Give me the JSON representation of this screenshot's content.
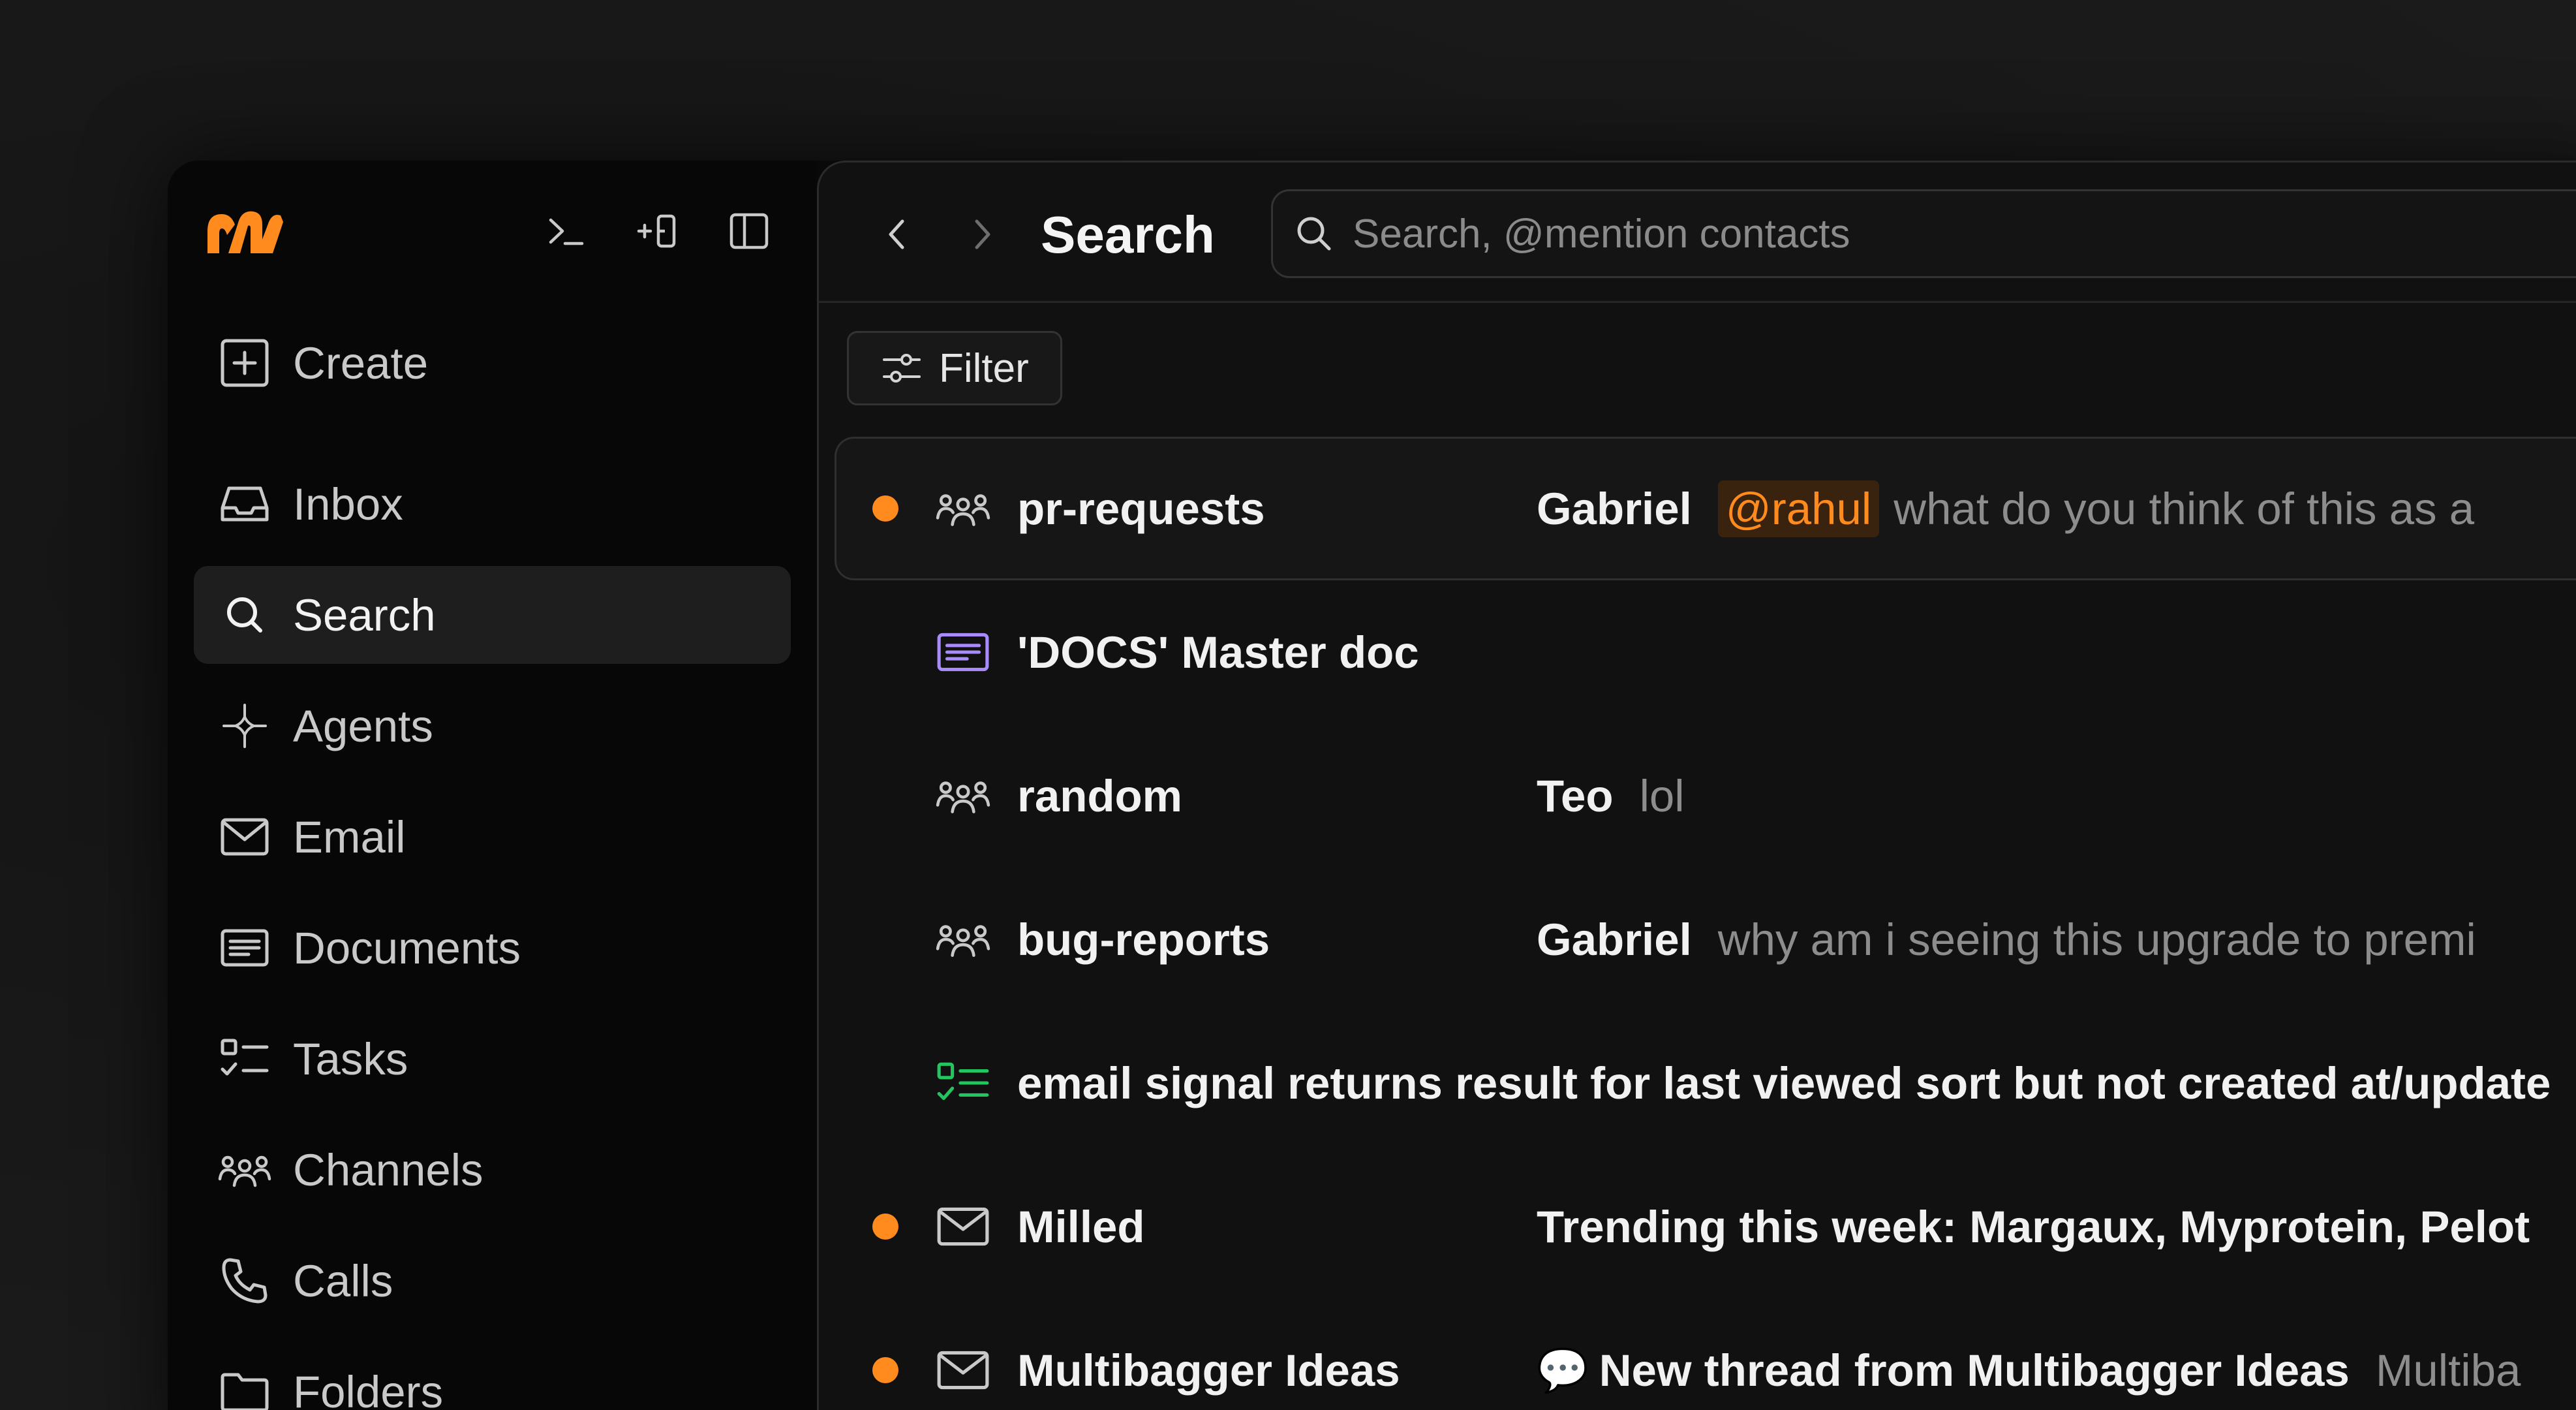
{
  "sidebar": {
    "tools": [
      {
        "icon": "terminal-icon"
      },
      {
        "icon": "add-panel-icon"
      },
      {
        "icon": "sidebar-toggle-icon"
      }
    ],
    "create_label": "Create",
    "items": [
      {
        "label": "Inbox",
        "icon": "inbox-icon"
      },
      {
        "label": "Search",
        "icon": "search-icon"
      },
      {
        "label": "Agents",
        "icon": "agents-icon"
      },
      {
        "label": "Email",
        "icon": "mail-icon"
      },
      {
        "label": "Documents",
        "icon": "document-icon"
      },
      {
        "label": "Tasks",
        "icon": "tasks-icon"
      },
      {
        "label": "Channels",
        "icon": "channels-icon"
      },
      {
        "label": "Calls",
        "icon": "phone-icon"
      },
      {
        "label": "Folders",
        "icon": "folder-icon"
      }
    ],
    "active_item": "Search"
  },
  "header": {
    "title": "Search",
    "search_placeholder": "Search, @mention contacts",
    "search_value": ""
  },
  "filter": {
    "label": "Filter"
  },
  "results": [
    {
      "type": "channel",
      "unread": true,
      "title": "pr-requests",
      "sender": "Gabriel",
      "mention": "@rahul",
      "preview": "what do you think of this as a"
    },
    {
      "type": "document",
      "unread": false,
      "title": "'DOCS' Master doc"
    },
    {
      "type": "channel",
      "unread": false,
      "title": "random",
      "sender": "Teo",
      "preview": "lol"
    },
    {
      "type": "channel",
      "unread": false,
      "title": "bug-reports",
      "sender": "Gabriel",
      "preview": "why am i seeing this upgrade to premi"
    },
    {
      "type": "task",
      "unread": false,
      "title": "email signal returns result for last viewed sort but not created at/update"
    },
    {
      "type": "email",
      "unread": true,
      "title": "Milled",
      "subject": "Trending this week: Margaux, Myprotein, Pelot"
    },
    {
      "type": "email",
      "unread": true,
      "title": "Multibagger Ideas",
      "bubble": "💬",
      "subject": "New thread from Multibagger Ideas",
      "preview": "Multiba"
    }
  ],
  "colors": {
    "accent": "#ff8a1e",
    "document_icon": "#a78bfa",
    "task_icon": "#22c55e",
    "background": "#111111"
  }
}
